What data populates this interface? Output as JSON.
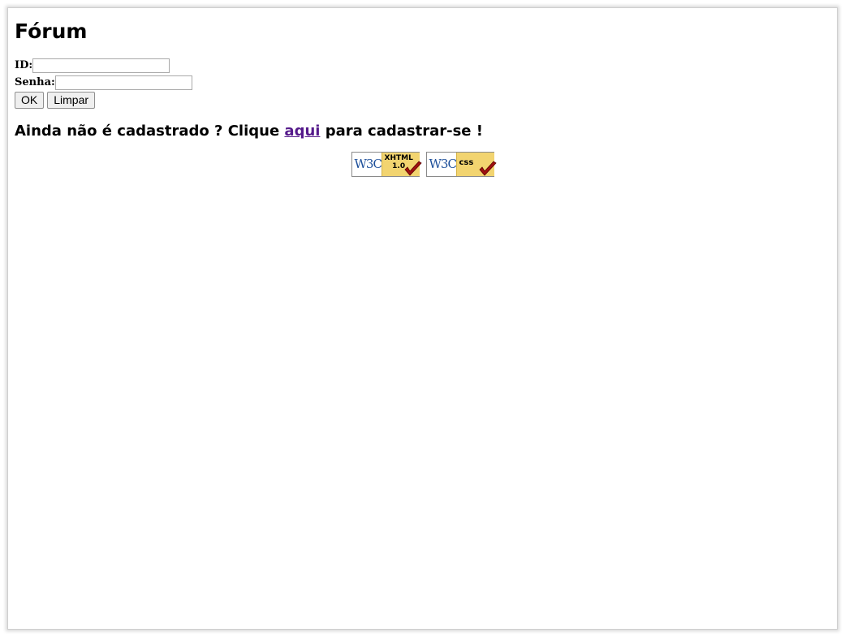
{
  "page": {
    "title": "Fórum"
  },
  "login": {
    "id_label": "ID:",
    "id_value": "",
    "password_label": "Senha:",
    "password_value": "",
    "ok_button": "OK",
    "clear_button": "Limpar"
  },
  "signup": {
    "prefix": "Ainda não é cadastrado ? Clique ",
    "link_text": "aqui",
    "suffix": " para cadastrar-se !"
  },
  "badges": [
    {
      "mark": "W3C",
      "label_line1": "XHTML",
      "label_line2": "1.0"
    },
    {
      "mark": "W3C",
      "label_line1": "css"
    }
  ],
  "colors": {
    "link_visited": "#551a8b",
    "badge_yellow": "#f2d470",
    "check_red": "#a01010",
    "w3c_blue": "#1d4f9a"
  }
}
